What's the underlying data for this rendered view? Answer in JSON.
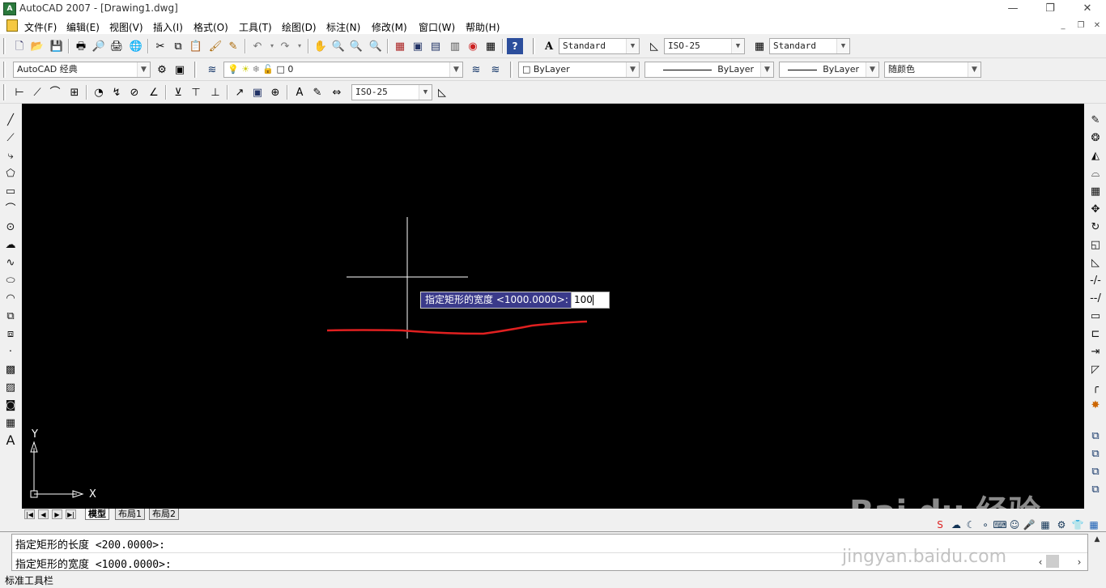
{
  "window": {
    "title": "AutoCAD 2007 - [Drawing1.dwg]",
    "app_icon_text": "A",
    "minimize": "—",
    "maximize": "❐",
    "close": "✕"
  },
  "menu": {
    "items": [
      "文件(F)",
      "编辑(E)",
      "视图(V)",
      "插入(I)",
      "格式(O)",
      "工具(T)",
      "绘图(D)",
      "标注(N)",
      "修改(M)",
      "窗口(W)",
      "帮助(H)"
    ],
    "mdi_minimize": "_",
    "mdi_restore": "❐",
    "mdi_close": "✕"
  },
  "styles_toolbar": {
    "text_style": "Standard",
    "dim_style": "ISO-25",
    "table_style": "Standard"
  },
  "layers_toolbar": {
    "workspace": "AutoCAD 经典",
    "layer": "0",
    "color": "ByLayer",
    "linetype": "ByLayer",
    "lineweight": "ByLayer",
    "plotstyle": "随颜色"
  },
  "dim_toolbar": {
    "dim_style": "ISO-25"
  },
  "canvas": {
    "background": "#000000",
    "crosshair_color": "#ffffff",
    "annotation_color": "#e02020",
    "dynamic_prompt": "指定矩形的宽度 <1000.0000>:",
    "dynamic_input_value": "100",
    "ucs_y_label": "Y",
    "ucs_x_label": "X"
  },
  "tabs": {
    "items": [
      "模型",
      "布局1",
      "布局2"
    ],
    "active": "模型"
  },
  "command": {
    "lines": [
      "指定矩形的长度 <200.0000>:",
      "指定矩形的宽度 <1000.0000>:"
    ]
  },
  "status": {
    "text": "标准工具栏"
  },
  "watermark": {
    "brand": "Bai du 经验",
    "url": "jingyan.baidu.com"
  }
}
